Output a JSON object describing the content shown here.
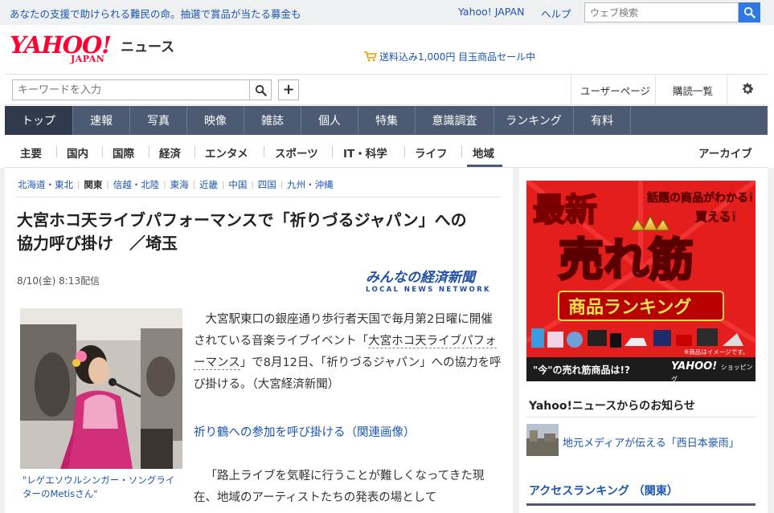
{
  "topbar": {
    "promo": "あなたの支援で助けられる難民の命。抽選で賞品が当たる募金も",
    "yahoo_japan": "Yahoo! JAPAN",
    "help": "ヘルプ",
    "web_search_placeholder": "ウェブ検索"
  },
  "logo": {
    "yahoo": "YAHOO!",
    "japan": "JAPAN",
    "news": "ニュース"
  },
  "cart_promo": "送料込み1,000円 目玉商品セール中",
  "search": {
    "keyword_placeholder": "キーワードを入力",
    "user_page": "ユーザーページ",
    "subscriptions": "購読一覧"
  },
  "global_nav": [
    "トップ",
    "速報",
    "写真",
    "映像",
    "雑誌",
    "個人",
    "特集",
    "意識調査",
    "ランキング",
    "有料"
  ],
  "sub_nav": [
    "主要",
    "国内",
    "国際",
    "経済",
    "エンタメ",
    "スポーツ",
    "IT・科学",
    "ライフ",
    "地域"
  ],
  "archive": "アーカイブ",
  "region_tabs": [
    "北海道・東北",
    "関東",
    "信越・北陸",
    "東海",
    "近畿",
    "中国",
    "四国",
    "九州・沖縄"
  ],
  "article": {
    "headline_line1": "大宮ホコ天ライブパフォーマンスで「祈りづるジャパン」への",
    "headline_line2": "協力呼び掛け　／埼玉",
    "date": "8/10(金) 8:13配信",
    "source_jp": "みんなの経済新聞",
    "source_en": "LOCAL NEWS NETWORK",
    "caption": "\"レゲエソウルシンガー・ソングライターのMetisさん\"",
    "para1_a": "大宮駅東口の銀座通り歩行者天国で毎月第2日曜に開催されている音楽ライブイベント「",
    "para1_link": "大宮ホコ天ライブパフォーマンス",
    "para1_b": "」で8月12日、「祈りづるジャパン」への協力を呼び掛ける。（大宮経済新聞）",
    "related_link": "祈り鶴への参加を呼び掛ける（関連画像）",
    "para2": "「路上ライブを気軽に行うことが難しくなってきた現在、地域のアーティストたちの発表の場として"
  },
  "ad": {
    "saishin": "最新",
    "tagline1": "話題の商品がわかる！",
    "tagline2": "買える！",
    "big": "売れ筋",
    "ranking": "商品ランキング",
    "note": "※商品はイメージです。",
    "bottom_text": "\"今\"の売れ筋商品は!?",
    "bottom_logo": "YAHOO!",
    "bottom_logo_sub": "ショッピング"
  },
  "sidebar": {
    "notice_title": "Yahoo!ニュースからのお知らせ",
    "notice_item": "地元メディアが伝える「西日本豪雨」",
    "access_title": "アクセスランキング （関東）"
  },
  "colors": {
    "nav_bg": "#4c5b73",
    "link": "#1a55b0",
    "brand_red": "#ff0033"
  }
}
